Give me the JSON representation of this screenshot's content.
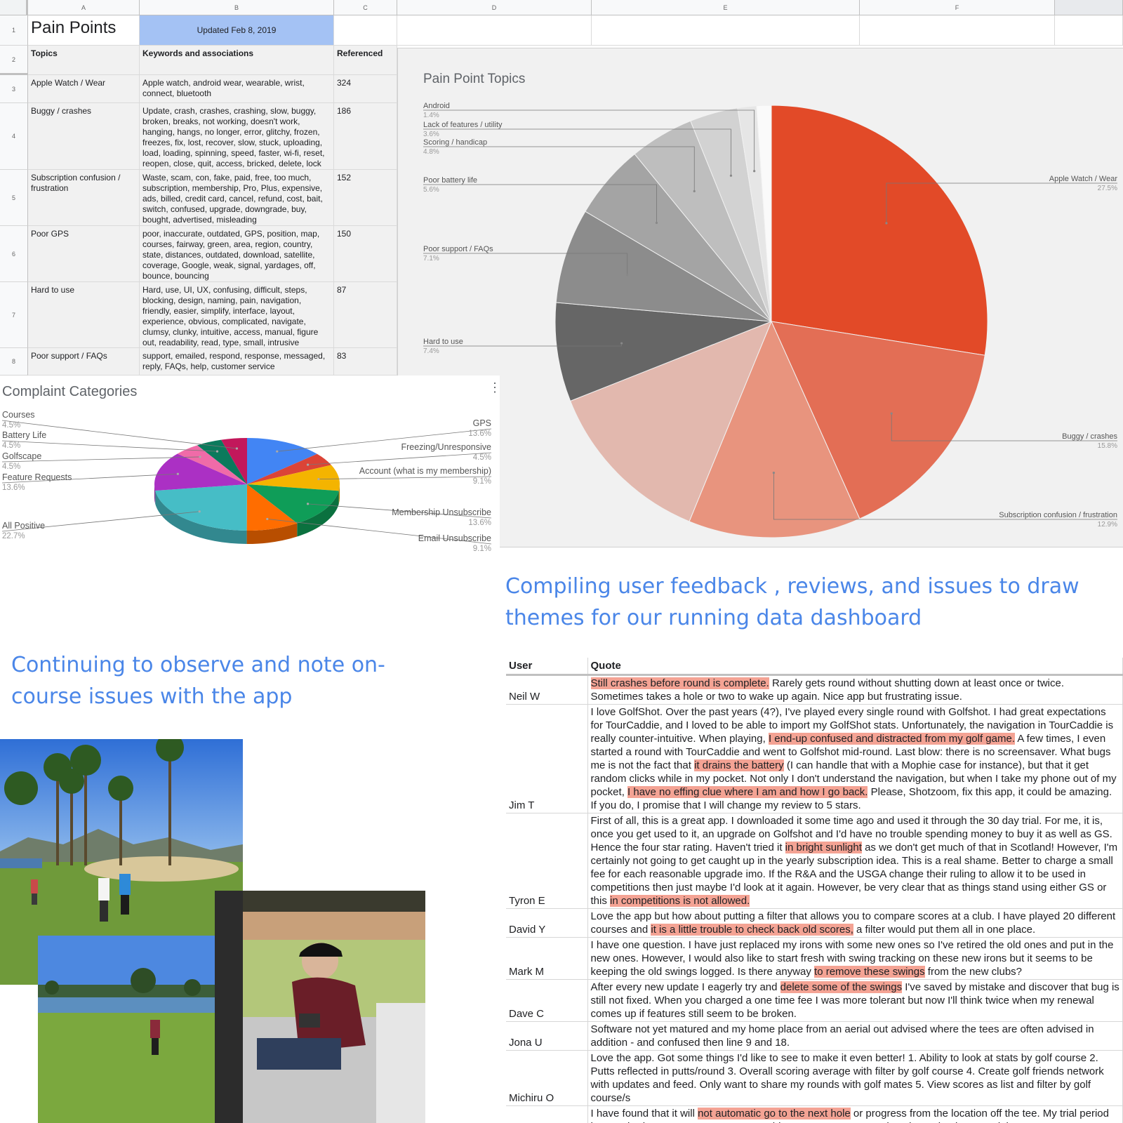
{
  "sheet": {
    "columns": [
      "A",
      "B",
      "C",
      "D",
      "E",
      "F"
    ],
    "row_numbers": [
      "1",
      "2",
      "3",
      "4",
      "5",
      "6",
      "7",
      "8"
    ],
    "title": "Pain Points",
    "updated": "Updated Feb 8, 2019",
    "headers": {
      "topics": "Topics",
      "keywords": "Keywords and associations",
      "referenced": "Referenced"
    },
    "rows": [
      {
        "topic": "Apple Watch / Wear",
        "keywords": "Apple watch, android wear, wearable, wrist, connect, bluetooth",
        "referenced": "324"
      },
      {
        "topic": "Buggy / crashes",
        "keywords": "Update, crash, crashes, crashing, slow, buggy, broken, breaks, not working, doesn't work, hanging, hangs, no longer, error, glitchy, frozen, freezes, fix, lost, recover, slow, stuck, uploading, load, loading, spinning, speed, faster, wi-fi, reset, reopen, close, quit, access, bricked, delete, lock",
        "referenced": "186"
      },
      {
        "topic": "Subscription confusion / frustration",
        "keywords": "Waste, scam, con, fake, paid, free, too much, subscription, membership, Pro, Plus, expensive, ads, billed, credit card, cancel, refund, cost, bait, switch, confused, upgrade, downgrade, buy, bought, advertised, misleading",
        "referenced": "152"
      },
      {
        "topic": "Poor GPS",
        "keywords": "poor, inaccurate, outdated, GPS, position, map, courses, fairway, green, area, region, country, state, distances, outdated, download, satellite, coverage, Google, weak, signal, yardages, off, bounce, bouncing",
        "referenced": "150"
      },
      {
        "topic": "Hard to use",
        "keywords": "Hard, use, UI, UX, confusing, difficult, steps, blocking, design, naming, pain, navigation, friendly, easier, simplify, interface, layout, experience, obvious, complicated, navigate, clumsy, clunky, intuitive, access, manual, figure out, readability, read, type, small, intrusive",
        "referenced": "87"
      },
      {
        "topic": "Poor support / FAQs",
        "keywords": "support, emailed, respond, response, messaged, reply, FAQs, help, customer service",
        "referenced": "83"
      }
    ]
  },
  "chart_data": [
    {
      "type": "pie",
      "title": "Pain Point Topics",
      "slices": [
        {
          "label": "Apple Watch / Wear",
          "value": 27.5,
          "display": "27.5%",
          "color": "#e24a28"
        },
        {
          "label": "Buggy / crashes",
          "value": 15.8,
          "display": "15.8%",
          "color": "#e36e55"
        },
        {
          "label": "Subscription confusion / frustration",
          "value": 12.9,
          "display": "12.9%",
          "color": "#e8947e"
        },
        {
          "label": "",
          "value": 12.8,
          "display": "",
          "color": "#e2b8ae"
        },
        {
          "label": "Hard to use",
          "value": 7.4,
          "display": "7.4%",
          "color": "#666666"
        },
        {
          "label": "Poor support / FAQs",
          "value": 7.1,
          "display": "7.1%",
          "color": "#8c8c8c"
        },
        {
          "label": "Poor battery life",
          "value": 5.6,
          "display": "5.6%",
          "color": "#a4a4a4"
        },
        {
          "label": "Scoring / handicap",
          "value": 4.8,
          "display": "4.8%",
          "color": "#bebebe"
        },
        {
          "label": "Lack of features / utility",
          "value": 3.6,
          "display": "3.6%",
          "color": "#d2d2d2"
        },
        {
          "label": "Android",
          "value": 1.4,
          "display": "1.4%",
          "color": "#e6e6e6"
        },
        {
          "label": "",
          "value": 1.1,
          "display": "",
          "color": "#fafafa"
        }
      ]
    },
    {
      "type": "pie",
      "title": "Complaint Categories",
      "slices": [
        {
          "label": "GPS",
          "value": 13.6,
          "display": "13.6%",
          "color": "#4285f4"
        },
        {
          "label": "Freezing/Unresponsive",
          "value": 4.5,
          "display": "4.5%",
          "color": "#db4437"
        },
        {
          "label": "Account (what is my membership)",
          "value": 9.1,
          "display": "9.1%",
          "color": "#f4b400"
        },
        {
          "label": "Membership Unsubscribe",
          "value": 13.6,
          "display": "13.6%",
          "color": "#0f9d58"
        },
        {
          "label": "Email Unsubscribe",
          "value": 9.1,
          "display": "9.1%",
          "color": "#ff6d00"
        },
        {
          "label": "All Positive",
          "value": 22.7,
          "display": "22.7%",
          "color": "#46bdc6"
        },
        {
          "label": "Feature Requests",
          "value": 13.6,
          "display": "13.6%",
          "color": "#ab30c4"
        },
        {
          "label": "Golfscape",
          "value": 4.5,
          "display": "4.5%",
          "color": "#f06ba8"
        },
        {
          "label": "Battery Life",
          "value": 4.5,
          "display": "4.5%",
          "color": "#0b7a5c"
        },
        {
          "label": "Courses",
          "value": 4.5,
          "display": "4.5%",
          "color": "#c2185b"
        }
      ]
    }
  ],
  "headings": {
    "right": "Compiling user feedback , reviews, and issues to draw themes for our running data dashboard",
    "left": "Continuing to observe and note on-course issues with the app"
  },
  "quotes": {
    "headers": {
      "user": "User",
      "quote": "Quote"
    },
    "rows": [
      {
        "user": "Neil W",
        "parts": [
          {
            "t": "Still crashes before round is complete.",
            "h": true
          },
          {
            "t": " Rarely gets round without shutting down at least once or twice. Sometimes takes a hole or two to wake up again. Nice app but frustrating issue."
          }
        ]
      },
      {
        "user": "Jim T",
        "parts": [
          {
            "t": "I love GolfShot. Over the past years (4?), I've played every single round with Golfshot. I had great expectations for TourCaddie, and I loved to be able to import my GolfShot stats. Unfortunately, the navigation in TourCaddie is really counter-intuitive. When playing, "
          },
          {
            "t": "I end-up confused and distracted from my golf game.",
            "h": true
          },
          {
            "t": " A few times, I even started a round with TourCaddie and went to Golfshot mid-round. Last blow: there is no screensaver. What bugs me is not the fact that "
          },
          {
            "t": "it drains the battery",
            "h": true
          },
          {
            "t": " (I can handle that with a Mophie case for instance), but that it get random clicks while in my pocket. Not only I don't understand the navigation, but when I take my phone out of my pocket, "
          },
          {
            "t": "I have no effing clue where I am and how I go back.",
            "h": true
          },
          {
            "t": " Please, Shotzoom, fix this app, it could be amazing. If you do, I promise that I will change my review to 5 stars."
          }
        ]
      },
      {
        "user": "Tyron E",
        "parts": [
          {
            "t": "First of all, this is a great app. I downloaded it some time ago and used it through the 30 day trial. For me, it is, once you get used to it, an upgrade on Golfshot and I'd have no trouble spending money to buy it as well as GS. Hence the four star rating. Haven't tried it "
          },
          {
            "t": "in bright sunlight",
            "h": true
          },
          {
            "t": " as we don't get much of that in Scotland! However, I'm certainly not going to get caught up in the yearly subscription idea. This is a real shame. Better to charge a small fee for each reasonable upgrade imo. If the R&A and the USGA change their ruling to allow it to be used in competitions then just maybe I'd look at it again. However, be very clear that as things stand using either GS or this "
          },
          {
            "t": "in competitions is not allowed.",
            "h": true
          }
        ]
      },
      {
        "user": "David Y",
        "parts": [
          {
            "t": "Love the app but how about putting a filter that allows you to compare scores at a club. I have played 20 different courses and "
          },
          {
            "t": "it is a little trouble to check back old scores,",
            "h": true
          },
          {
            "t": " a filter would put them all in one place."
          }
        ]
      },
      {
        "user": "Mark M",
        "parts": [
          {
            "t": "I have one question. I have just replaced my irons with some new ones so I've retired the old ones and put in the new ones. However, I would also like to start fresh with swing tracking on these new irons but it seems to be keeping the old swings logged. Is there anyway "
          },
          {
            "t": "to remove these swings",
            "h": true
          },
          {
            "t": " from the new clubs?"
          }
        ]
      },
      {
        "user": "Dave C",
        "parts": [
          {
            "t": "After every new update I eagerly try and "
          },
          {
            "t": "delete some of the swings",
            "h": true
          },
          {
            "t": " I've saved by mistake and discover that bug is still not fixed. When you charged a one time fee I was more tolerant but now I'll think twice when my renewal comes up if features still seem to be broken."
          }
        ]
      },
      {
        "user": "Jona U",
        "parts": [
          {
            "t": "Software not yet matured and my home place from an aerial out advised where the tees are often advised in addition - and confused then line 9 and 18."
          }
        ]
      },
      {
        "user": "Michiru O",
        "parts": [
          {
            "t": "Love the app. Got some things I'd like to see to make it even better! 1. Ability to look at stats by golf course 2. Putts reflected in putts/round 3. Overall scoring average with filter by golf course 4. Create golf friends network with updates and feed. Only want to share my rounds with golf mates 5. View scores as list and filter by golf course/s"
          }
        ]
      },
      {
        "user": "",
        "parts": [
          {
            "t": "I have found that it will "
          },
          {
            "t": "not automatic go to the next hole",
            "h": true
          },
          {
            "t": " or progress from the location off the tee. My trial period has expired, I guess. I can not access this App anymore. It needs to be revised to wear it is a FREE"
          }
        ]
      }
    ]
  }
}
